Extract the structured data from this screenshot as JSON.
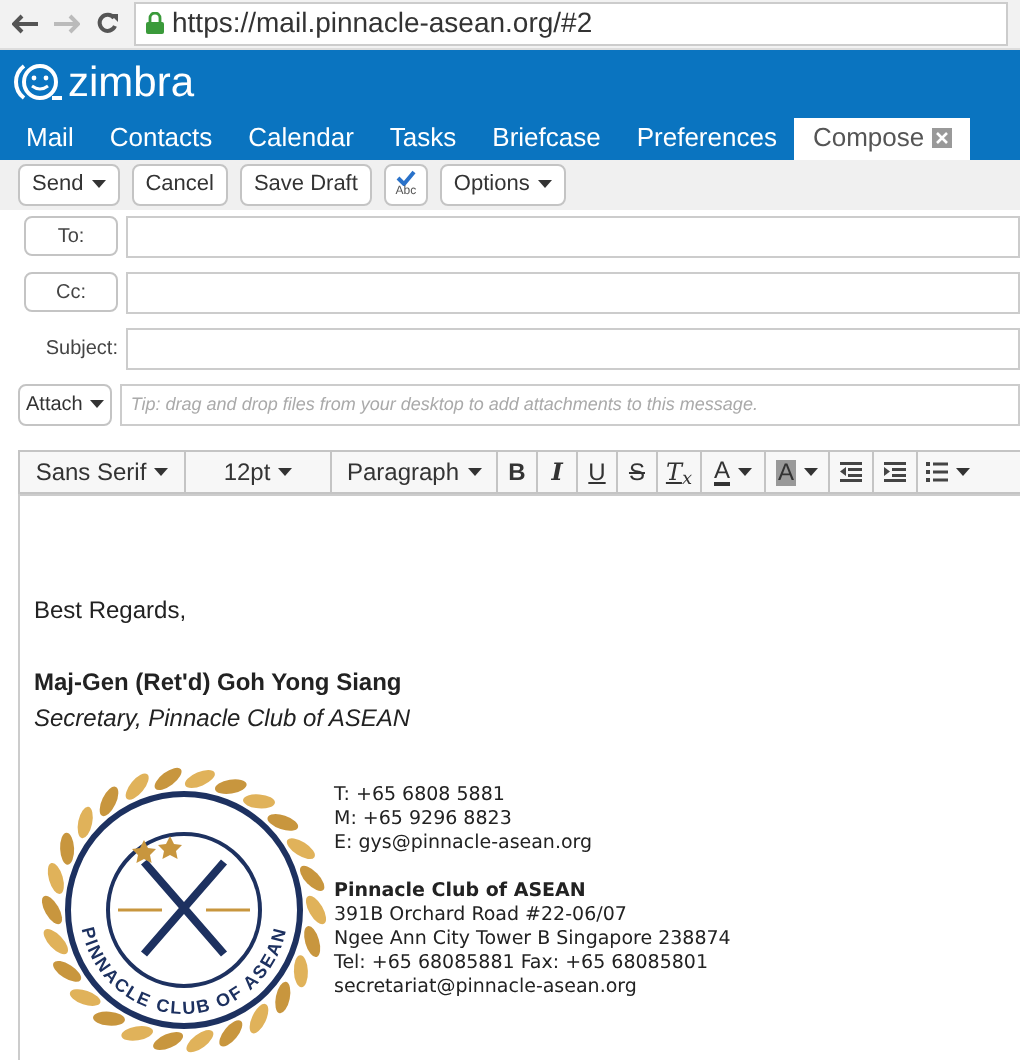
{
  "browser": {
    "url": "https://mail.pinnacle-asean.org/#2"
  },
  "app": {
    "logo_text": "zimbra"
  },
  "tabs": [
    {
      "label": "Mail",
      "selected": false,
      "closable": false
    },
    {
      "label": "Contacts",
      "selected": false,
      "closable": false
    },
    {
      "label": "Calendar",
      "selected": false,
      "closable": false
    },
    {
      "label": "Tasks",
      "selected": false,
      "closable": false
    },
    {
      "label": "Briefcase",
      "selected": false,
      "closable": false
    },
    {
      "label": "Preferences",
      "selected": false,
      "closable": false
    },
    {
      "label": "Compose",
      "selected": true,
      "closable": true
    }
  ],
  "toolbar": [
    {
      "kind": "dropdown",
      "label": "Send"
    },
    {
      "kind": "button",
      "label": "Cancel"
    },
    {
      "kind": "button",
      "label": "Save Draft"
    },
    {
      "kind": "spellcheck",
      "label": "Abc"
    },
    {
      "kind": "dropdown",
      "label": "Options"
    }
  ],
  "fields": [
    {
      "kind": "button",
      "label": "To:"
    },
    {
      "kind": "button",
      "label": "Cc:"
    },
    {
      "kind": "plain",
      "label": "Subject:"
    }
  ],
  "attach": {
    "label": "Attach",
    "placeholder": "Tip: drag and drop files from your desktop to add attachments to this message."
  },
  "format_toolbar": [
    {
      "kind": "select",
      "label": "Sans Serif"
    },
    {
      "kind": "select",
      "label": "12pt"
    },
    {
      "kind": "select",
      "label": "Paragraph"
    },
    {
      "kind": "bold",
      "label": "B"
    },
    {
      "kind": "italic",
      "label": "I"
    },
    {
      "kind": "underline",
      "label": "U"
    },
    {
      "kind": "strike",
      "label": "S"
    },
    {
      "kind": "clear",
      "label": "T$_{x}$"
    },
    {
      "kind": "color",
      "label": "A"
    },
    {
      "kind": "highlight",
      "label": "A"
    },
    {
      "kind": "outdent"
    },
    {
      "kind": "indent"
    },
    {
      "kind": "list"
    }
  ],
  "body": {
    "greeting": "Best Regards,",
    "name": "Maj-Gen (Ret'd) Goh Yong Siang",
    "title": "Secretary, Pinnacle Club of ASEAN",
    "logo_text": "PINNACLE CLUB OF ASEAN",
    "contacts": [
      "T: +65 6808 5881",
      "M: +65 9296 8823",
      "E: gys@pinnacle-asean.org"
    ],
    "org": "Pinnacle Club of ASEAN",
    "address": [
      "391B Orchard Road #22-06/07",
      "Ngee Ann City Tower B Singapore 238874",
      "Tel: +65 68085881 Fax: +65 68085801",
      "secretariat@pinnacle-asean.org"
    ]
  }
}
